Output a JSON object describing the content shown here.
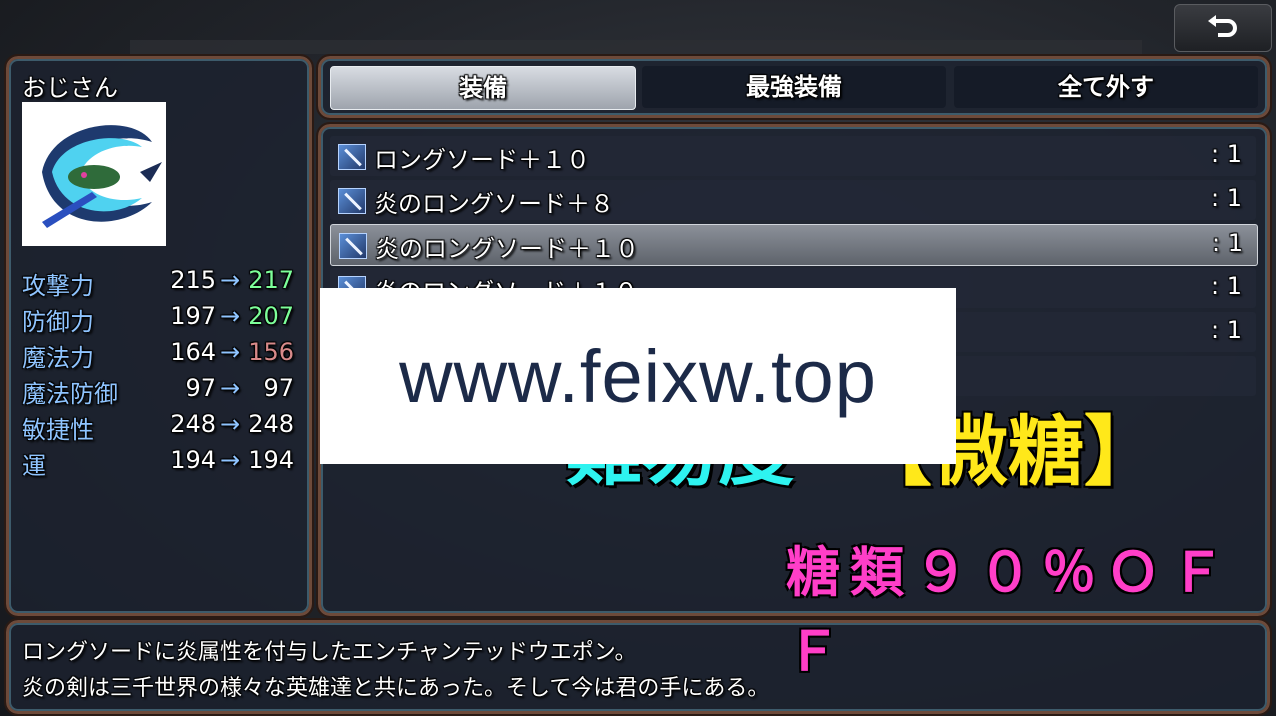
{
  "colors": {
    "param_label": "#8fc4ff",
    "param_up": "#7dff9a",
    "param_down": "#d88a8a",
    "overlay_cyan": "#2ef3f0",
    "overlay_yellow": "#ffe81a",
    "overlay_pink": "#ff3ec8",
    "overlay_red": "#ff2a2a"
  },
  "back_button": {
    "icon": "return-arrow-icon"
  },
  "actor": {
    "name": "おじさん",
    "face_icon": "dragon-portrait-icon",
    "params": [
      {
        "label": "攻撃力",
        "current": "215",
        "arrow": "→",
        "new": "217",
        "change": "up"
      },
      {
        "label": "防御力",
        "current": "197",
        "arrow": "→",
        "new": "207",
        "change": "up"
      },
      {
        "label": "魔法力",
        "current": "164",
        "arrow": "→",
        "new": "156",
        "change": "down"
      },
      {
        "label": "魔法防御",
        "current": "97",
        "arrow": "→",
        "new": "97",
        "change": "same"
      },
      {
        "label": "敏捷性",
        "current": "248",
        "arrow": "→",
        "new": "248",
        "change": "same"
      },
      {
        "label": "運",
        "current": "194",
        "arrow": "→",
        "new": "194",
        "change": "same"
      }
    ]
  },
  "commands": [
    {
      "label": "装備",
      "selected": true
    },
    {
      "label": "最強装備",
      "selected": false
    },
    {
      "label": "全て外す",
      "selected": false
    }
  ],
  "items": [
    {
      "name": "ロングソード＋１０",
      "count": ":  1",
      "icon": "sword-icon",
      "selected": false
    },
    {
      "name": "炎のロングソード＋８",
      "count": ":  1",
      "icon": "sword-icon",
      "selected": false
    },
    {
      "name": "炎のロングソード＋１０",
      "count": ":  1",
      "icon": "sword-icon",
      "selected": true
    },
    {
      "name": "炎のロングソード＋１０",
      "count": ":  1",
      "icon": "sword-icon",
      "selected": false
    },
    {
      "name": "",
      "count": ":  1",
      "icon": "sword-icon",
      "selected": false
    }
  ],
  "help": {
    "line1": "ロングソードに炎属性を付与したエンチャンテッドウエポン。",
    "line2": "炎の剣は三千世界の様々な英雄達と共にあった。そして今は君の手にある。"
  },
  "watermark": "www.feixw.top",
  "overlay": {
    "difficulty": "難易度",
    "bracket_text": "【微糖】",
    "sub": "糖類９０％ＯＦＦ"
  }
}
